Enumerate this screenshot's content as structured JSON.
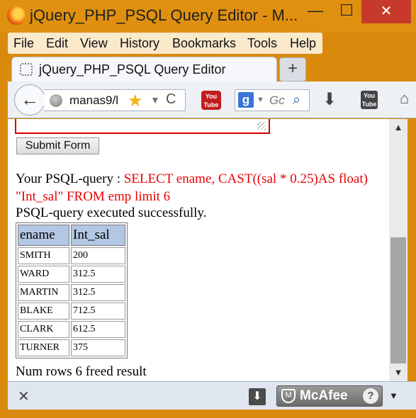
{
  "window": {
    "title": "jQuery_PHP_PSQL Query Editor - M...",
    "minimize": "—",
    "maximize": "☐",
    "close": "✕"
  },
  "menu": [
    "File",
    "Edit",
    "View",
    "History",
    "Bookmarks",
    "Tools",
    "Help"
  ],
  "tab": {
    "title": "jQuery_PHP_PSQL Query Editor",
    "new_tab": "+"
  },
  "nav": {
    "back": "←",
    "url": "manas9/l",
    "star": "★",
    "dropdown": "▼",
    "reload": "C",
    "youtube_label": "You Tube",
    "search_engine": "g",
    "search_placeholder": "Gc",
    "search_icon": "⌕",
    "download": "⬇",
    "youtube2_label": "You Tube",
    "home": "⌂"
  },
  "form": {
    "submit_label": "Submit Form"
  },
  "query": {
    "label": "Your PSQL-query : ",
    "value": "SELECT ename, CAST((sal * 0.25)AS float) \"Int_sal\" FROM emp limit 6",
    "status": "PSQL-query executed successfully."
  },
  "results": {
    "columns": [
      "ename",
      "Int_sal"
    ],
    "rows": [
      [
        "SMITH",
        "200"
      ],
      [
        "WARD",
        "312.5"
      ],
      [
        "MARTIN",
        "312.5"
      ],
      [
        "BLAKE",
        "712.5"
      ],
      [
        "CLARK",
        "612.5"
      ],
      [
        "TURNER",
        "375"
      ]
    ],
    "footer": "Num rows 6 freed result"
  },
  "scrollbar": {
    "up": "▲",
    "down": "▼",
    "position": 0.8
  },
  "bottom": {
    "close": "✕",
    "download": "⬇",
    "mcafee_label": "McAfee",
    "mcafee_help": "?",
    "dropdown": "▼"
  },
  "colors": {
    "window_frame": "#e0900f",
    "query_value": "#e80000",
    "table_header": "#b3c6e3",
    "textarea_border": "#d60000"
  }
}
